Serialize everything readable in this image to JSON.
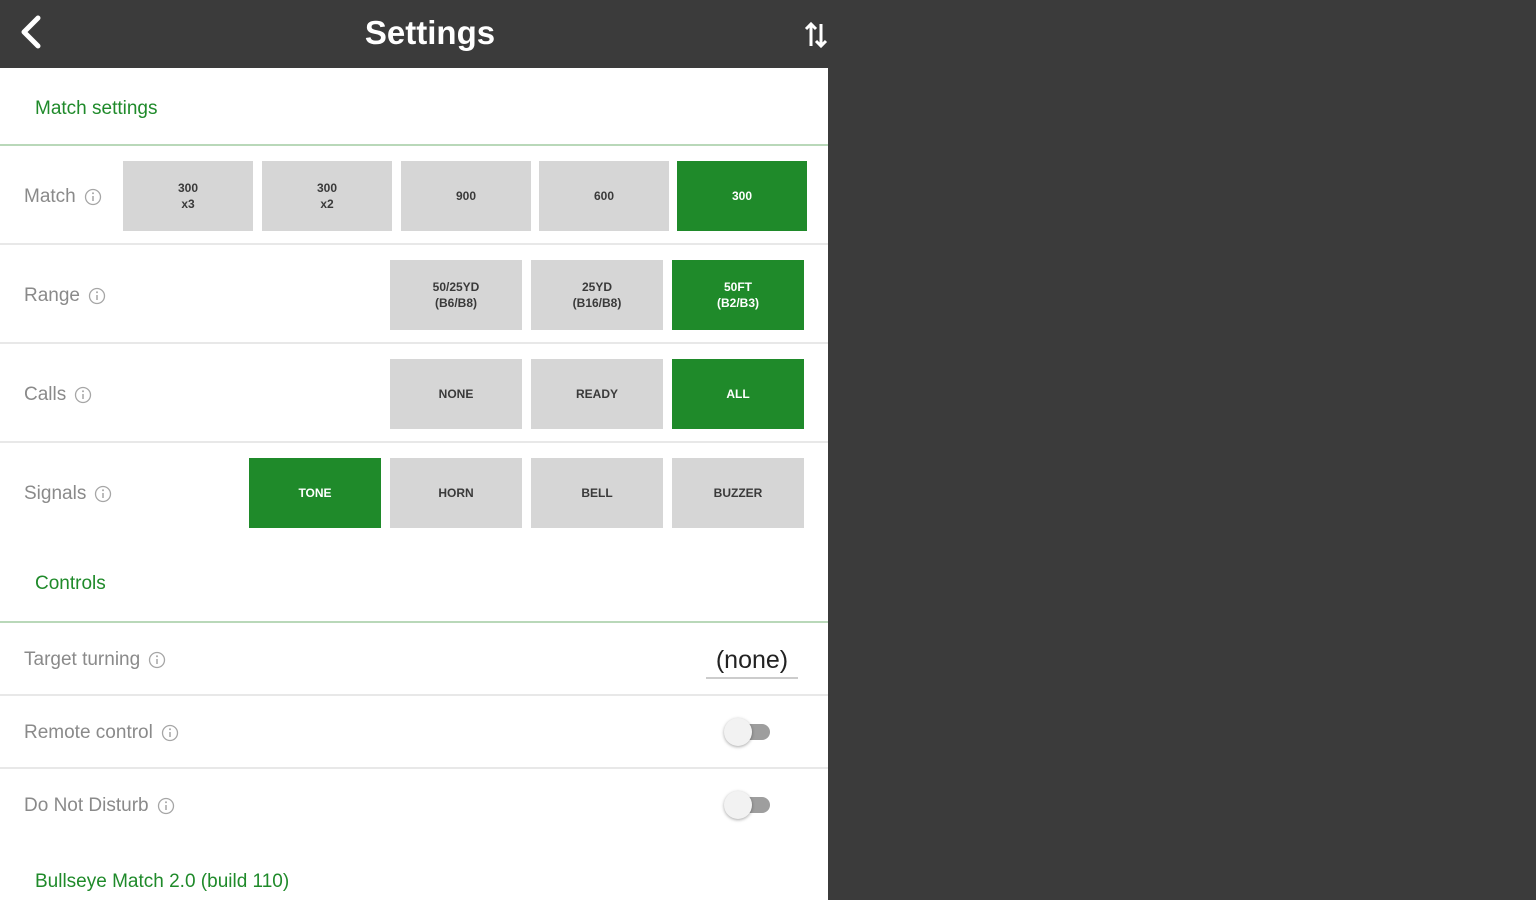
{
  "appbar": {
    "title": "Settings",
    "back_icon": "chevron-left-icon",
    "sort_icon": "swap-vertical-icon"
  },
  "sections": {
    "match_settings": "Match settings",
    "controls": "Controls"
  },
  "match": {
    "label": "Match",
    "options": [
      "300\nx3",
      "300\nx2",
      "900",
      "600",
      "300"
    ],
    "selected": "300"
  },
  "range": {
    "label": "Range",
    "options": [
      "50/25YD\n(B6/B8)",
      "25YD\n(B16/B8)",
      "50FT\n(B2/B3)"
    ],
    "selected": "50FT\n(B2/B3)"
  },
  "calls": {
    "label": "Calls",
    "options": [
      "NONE",
      "READY",
      "ALL"
    ],
    "selected": "ALL"
  },
  "signals": {
    "label": "Signals",
    "options": [
      "TONE",
      "HORN",
      "BELL",
      "BUZZER"
    ],
    "selected": "TONE"
  },
  "target_turning": {
    "label": "Target turning",
    "value": "(none)"
  },
  "remote_control": {
    "label": "Remote control",
    "enabled": false
  },
  "do_not_disturb": {
    "label": "Do Not Disturb",
    "enabled": false
  },
  "footer": {
    "version": "Bullseye Match 2.0 (build 110)"
  },
  "colors": {
    "accent": "#1f8a2a",
    "appbar": "#3b3b3b",
    "button_inactive": "#d6d6d6"
  }
}
